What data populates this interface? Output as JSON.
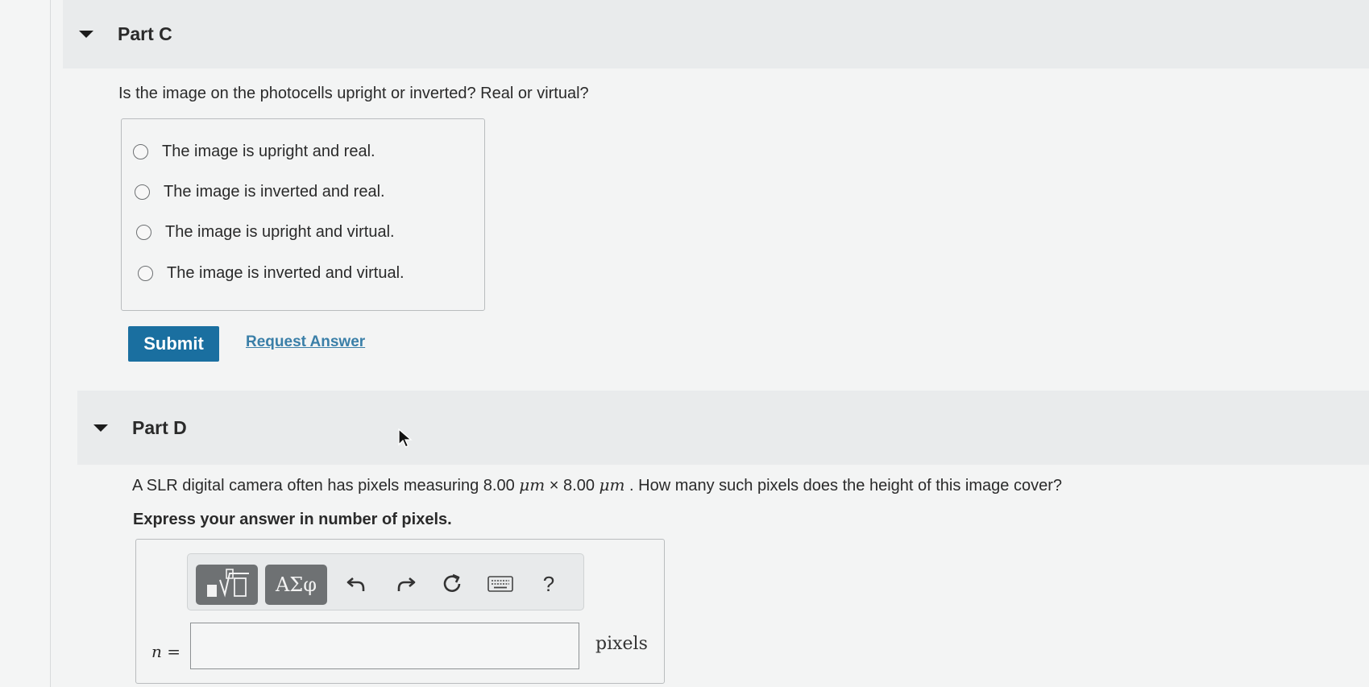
{
  "part_c": {
    "title": "Part C",
    "question": "Is the image on the photocells upright or inverted? Real or virtual?",
    "options": [
      {
        "label": "The image is upright and real."
      },
      {
        "label": "The image is inverted and real."
      },
      {
        "label": "The image is upright and virtual."
      },
      {
        "label": "The image is inverted and virtual."
      }
    ],
    "submit_label": "Submit",
    "request_answer_label": "Request Answer"
  },
  "part_d": {
    "title": "Part D",
    "question_prefix": "A SLR digital camera often has pixels measuring 8.00 ",
    "unit_um": "μm",
    "times": " × ",
    "dimension_2": "8.00 ",
    "question_suffix": " . How many such pixels does the height of this image cover?",
    "instruction": "Express your answer in number of pixels.",
    "toolbar": {
      "greek_label": "ΑΣφ",
      "help_label": "?"
    },
    "variable": "n",
    "equals": " =",
    "input_value": "",
    "unit": "pixels"
  },
  "colors": {
    "accent": "#1a6fa0",
    "link": "#3a7fa8",
    "header_bg": "#e9ebec"
  },
  "icons": [
    "caret-down-icon",
    "templates-icon",
    "undo-icon",
    "redo-icon",
    "reset-icon",
    "keyboard-icon",
    "mouse-cursor-icon"
  ]
}
